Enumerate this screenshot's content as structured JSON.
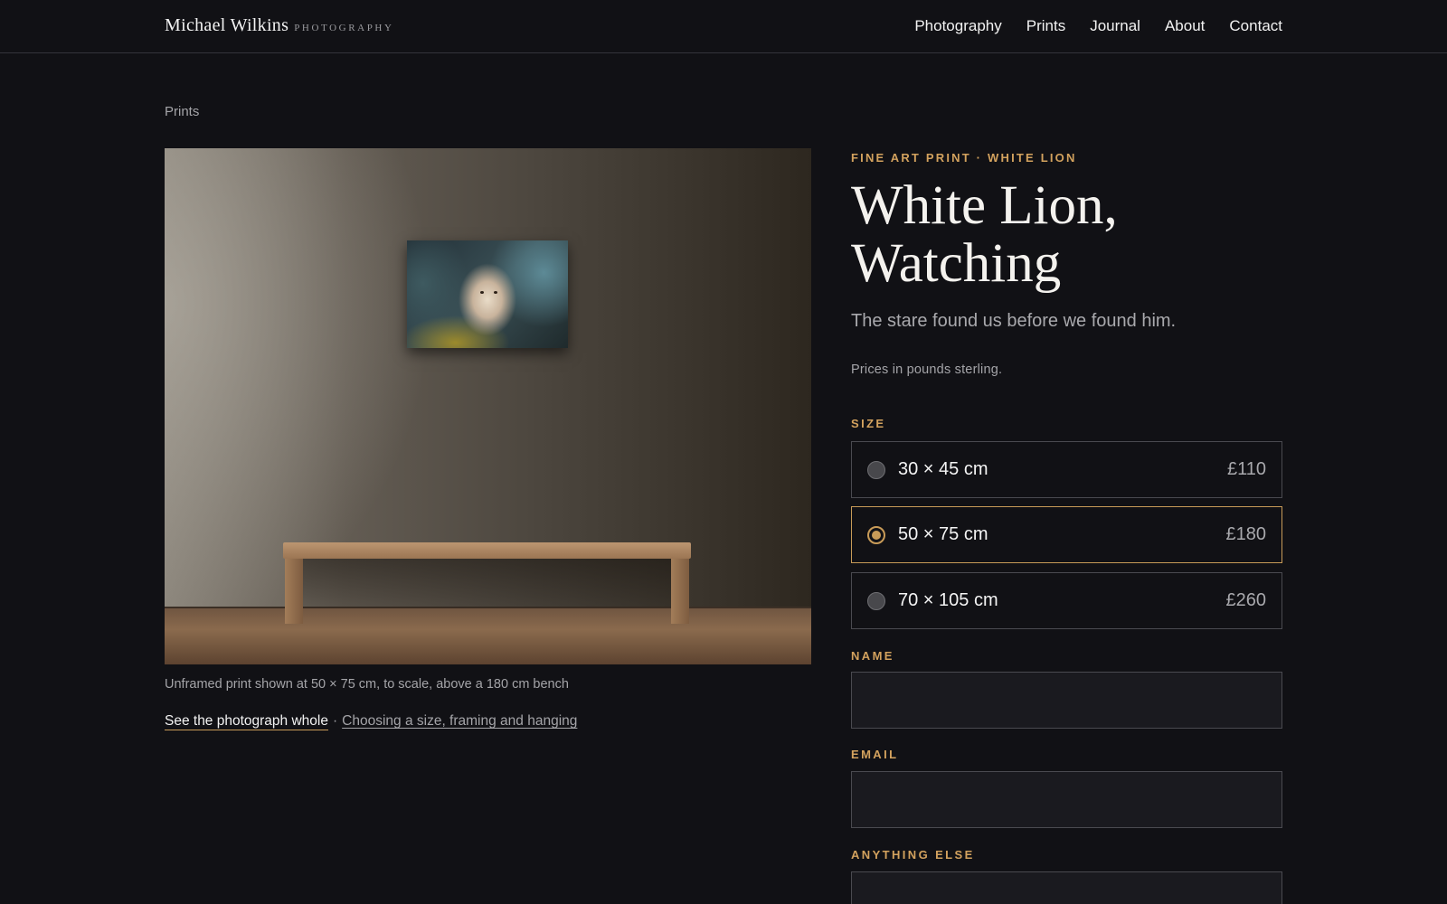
{
  "header": {
    "brand_name": "Michael Wilkins",
    "brand_sub": "PHOTOGRAPHY",
    "nav": [
      "Photography",
      "Prints",
      "Journal",
      "About",
      "Contact"
    ]
  },
  "breadcrumb": "Prints",
  "image": {
    "caption": "Unframed print shown at 50 × 75 cm, to scale, above a 180 cm bench"
  },
  "links": {
    "primary": "See the photograph whole",
    "separator": "·",
    "secondary": "Choosing a size, framing and hanging"
  },
  "product": {
    "eyebrow": "FINE ART PRINT · WHITE LION",
    "title": "White Lion, Watching",
    "subtitle": "The stare found us before we found him.",
    "note": "Prices in pounds sterling."
  },
  "form": {
    "size_label": "SIZE",
    "sizes": [
      {
        "size": "30 × 45 cm",
        "price": "£110",
        "selected": false
      },
      {
        "size": "50 × 75 cm",
        "price": "£180",
        "selected": true
      },
      {
        "size": "70 × 105 cm",
        "price": "£260",
        "selected": false
      }
    ],
    "name_label": "NAME",
    "email_label": "EMAIL",
    "anything_label": "ANYTHING ELSE"
  },
  "colors": {
    "background": "#111115",
    "accent": "#c89b58",
    "text": "#f4f2ee",
    "muted": "#a4a4a8"
  }
}
